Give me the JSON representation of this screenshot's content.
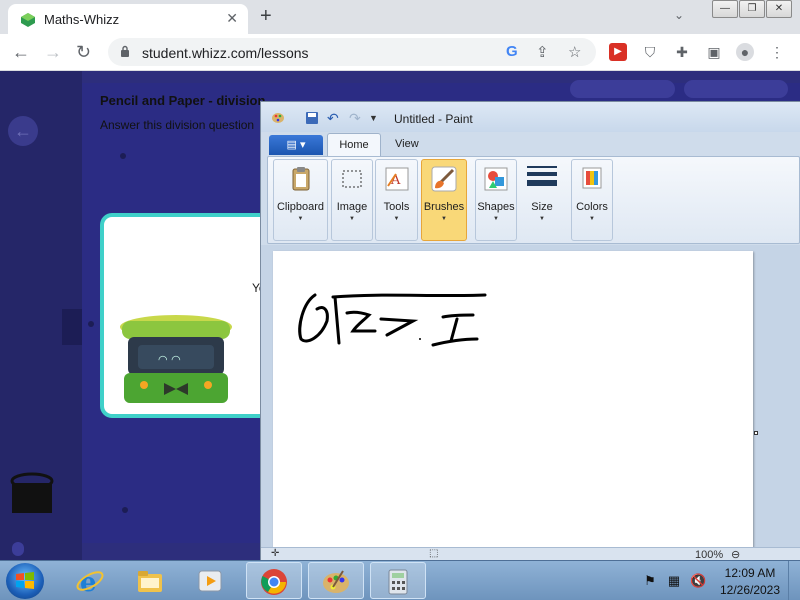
{
  "browser": {
    "tab_title": "Maths-Whizz",
    "url": "student.whizz.com/lessons",
    "new_tab_symbol": "+",
    "close_symbol": "✕"
  },
  "lesson": {
    "title": "Pencil and Paper - division",
    "subtitle": "Answer this division question",
    "card_text": "Yo"
  },
  "paint": {
    "window_title": "Untitled - Paint",
    "tabs": {
      "home": "Home",
      "view": "View"
    },
    "groups": {
      "clipboard": "Clipboard",
      "image": "Image",
      "tools": "Tools",
      "brushes": "Brushes",
      "shapes": "Shapes",
      "size": "Size",
      "colors": "Colors"
    },
    "zoom": "100%",
    "active_group": "Brushes"
  },
  "taskbar": {
    "time": "12:09 AM",
    "date": "12/26/2023"
  },
  "colors": {
    "page_bg": "#2d2e7c",
    "brushes_highlight": "#f9d878",
    "card_border": "#3fd0c9"
  }
}
